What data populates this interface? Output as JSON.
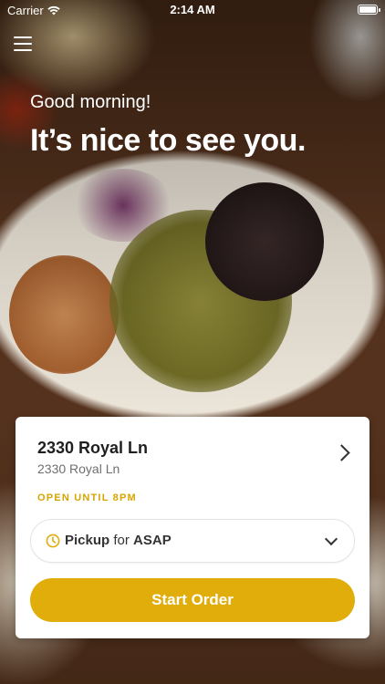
{
  "status_bar": {
    "carrier": "Carrier",
    "time": "2:14 AM"
  },
  "header": {
    "greeting": "Good morning!",
    "headline": "It’s nice to see you."
  },
  "location": {
    "name": "2330 Royal Ln",
    "address": "2330 Royal Ln",
    "hours": "OPEN UNTIL 8PM"
  },
  "order": {
    "mode": "Pickup",
    "for_word": "for",
    "time": "ASAP",
    "start_label": "Start Order"
  },
  "colors": {
    "accent": "#e0ad0b",
    "hours_text": "#d9a400"
  }
}
